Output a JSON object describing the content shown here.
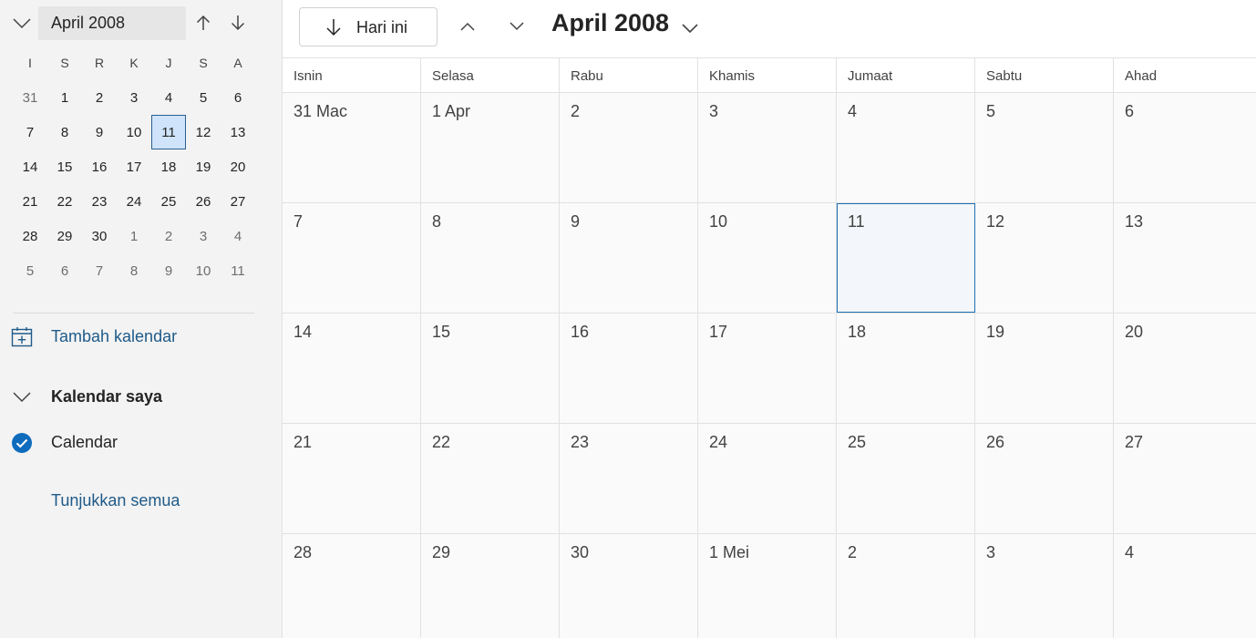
{
  "sidebar": {
    "mini_calendar": {
      "title": "April 2008",
      "weekday_labels": [
        "I",
        "S",
        "R",
        "K",
        "J",
        "S",
        "A"
      ],
      "weeks": [
        [
          {
            "d": "31",
            "muted": true
          },
          {
            "d": "1"
          },
          {
            "d": "2"
          },
          {
            "d": "3"
          },
          {
            "d": "4"
          },
          {
            "d": "5"
          },
          {
            "d": "6"
          }
        ],
        [
          {
            "d": "7"
          },
          {
            "d": "8"
          },
          {
            "d": "9"
          },
          {
            "d": "10"
          },
          {
            "d": "11",
            "selected": true
          },
          {
            "d": "12"
          },
          {
            "d": "13"
          }
        ],
        [
          {
            "d": "14"
          },
          {
            "d": "15"
          },
          {
            "d": "16"
          },
          {
            "d": "17"
          },
          {
            "d": "18"
          },
          {
            "d": "19"
          },
          {
            "d": "20"
          }
        ],
        [
          {
            "d": "21"
          },
          {
            "d": "22"
          },
          {
            "d": "23"
          },
          {
            "d": "24"
          },
          {
            "d": "25"
          },
          {
            "d": "26"
          },
          {
            "d": "27"
          }
        ],
        [
          {
            "d": "28"
          },
          {
            "d": "29"
          },
          {
            "d": "30"
          },
          {
            "d": "1",
            "muted": true
          },
          {
            "d": "2",
            "muted": true
          },
          {
            "d": "3",
            "muted": true
          },
          {
            "d": "4",
            "muted": true
          }
        ],
        [
          {
            "d": "5",
            "muted": true
          },
          {
            "d": "6",
            "muted": true
          },
          {
            "d": "7",
            "muted": true
          },
          {
            "d": "8",
            "muted": true
          },
          {
            "d": "9",
            "muted": true
          },
          {
            "d": "10",
            "muted": true
          },
          {
            "d": "11",
            "muted": true
          }
        ]
      ]
    },
    "add_calendar_label": "Tambah kalendar",
    "my_calendars_label": "Kalendar saya",
    "calendar_item_label": "Calendar",
    "show_all_label": "Tunjukkan semua"
  },
  "toolbar": {
    "today_label": "Hari ini",
    "month_title": "April 2008"
  },
  "month_view": {
    "weekday_headers": [
      "Isnin",
      "Selasa",
      "Rabu",
      "Khamis",
      "Jumaat",
      "Sabtu",
      "Ahad"
    ],
    "weeks": [
      [
        "31 Mac",
        "1 Apr",
        "2",
        "3",
        "4",
        "5",
        "6"
      ],
      [
        "7",
        "8",
        "9",
        "10",
        "11",
        "12",
        "13"
      ],
      [
        "14",
        "15",
        "16",
        "17",
        "18",
        "19",
        "20"
      ],
      [
        "21",
        "22",
        "23",
        "24",
        "25",
        "26",
        "27"
      ],
      [
        "28",
        "29",
        "30",
        "1 Mei",
        "2",
        "3",
        "4"
      ]
    ],
    "today_label": "11"
  },
  "colors": {
    "accent": "#1f6fb0",
    "link": "#1f5a88",
    "selected_bg": "#cfe4fa",
    "checkbox": "#0f6cbd"
  }
}
